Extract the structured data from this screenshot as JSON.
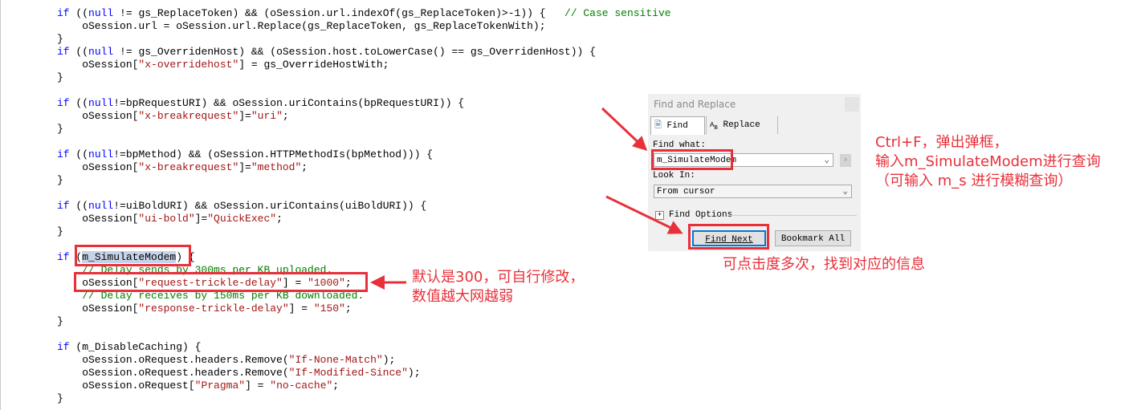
{
  "code_lines": [
    [
      [
        "k",
        "if"
      ],
      [
        "t",
        " (("
      ],
      [
        "k",
        "null"
      ],
      [
        "t",
        " != gs_ReplaceToken) && (oSession.url.indexOf(gs_ReplaceToken)>-1)) {   "
      ],
      [
        "c",
        "// Case sensitive"
      ]
    ],
    [
      [
        "t",
        "    oSession.url = oSession.url.Replace(gs_ReplaceToken, gs_ReplaceTokenWith);"
      ]
    ],
    [
      [
        "t",
        "}"
      ]
    ],
    [
      [
        "k",
        "if"
      ],
      [
        "t",
        " (("
      ],
      [
        "k",
        "null"
      ],
      [
        "t",
        " != gs_OverridenHost) && (oSession.host.toLowerCase() == gs_OverridenHost)) {"
      ]
    ],
    [
      [
        "t",
        "    oSession["
      ],
      [
        "s",
        "\"x-overridehost\""
      ],
      [
        "t",
        "] = gs_OverrideHostWith;"
      ]
    ],
    [
      [
        "t",
        "}"
      ]
    ],
    [],
    [
      [
        "k",
        "if"
      ],
      [
        "t",
        " (("
      ],
      [
        "k",
        "null"
      ],
      [
        "t",
        "!=bpRequestURI) && oSession.uriContains(bpRequestURI)) {"
      ]
    ],
    [
      [
        "t",
        "    oSession["
      ],
      [
        "s",
        "\"x-breakrequest\""
      ],
      [
        "t",
        "]="
      ],
      [
        "s",
        "\"uri\""
      ],
      [
        "t",
        ";"
      ]
    ],
    [
      [
        "t",
        "}"
      ]
    ],
    [],
    [
      [
        "k",
        "if"
      ],
      [
        "t",
        " (("
      ],
      [
        "k",
        "null"
      ],
      [
        "t",
        "!=bpMethod) && (oSession.HTTPMethodIs(bpMethod))) {"
      ]
    ],
    [
      [
        "t",
        "    oSession["
      ],
      [
        "s",
        "\"x-breakrequest\""
      ],
      [
        "t",
        "]="
      ],
      [
        "s",
        "\"method\""
      ],
      [
        "t",
        ";"
      ]
    ],
    [
      [
        "t",
        "}"
      ]
    ],
    [],
    [
      [
        "k",
        "if"
      ],
      [
        "t",
        " (("
      ],
      [
        "k",
        "null"
      ],
      [
        "t",
        "!=uiBoldURI) && oSession.uriContains(uiBoldURI)) {"
      ]
    ],
    [
      [
        "t",
        "    oSession["
      ],
      [
        "s",
        "\"ui-bold\""
      ],
      [
        "t",
        "]="
      ],
      [
        "s",
        "\"QuickExec\""
      ],
      [
        "t",
        ";"
      ]
    ],
    [
      [
        "t",
        "}"
      ]
    ],
    [],
    [
      [
        "k",
        "if"
      ],
      [
        "t",
        " ("
      ],
      [
        "h",
        "m_SimulateModem"
      ],
      [
        "t",
        ") {"
      ]
    ],
    [
      [
        "c",
        "    // Delay sends by 300ms per KB uploaded."
      ]
    ],
    [
      [
        "t",
        "    oSession["
      ],
      [
        "s",
        "\"request-trickle-delay\""
      ],
      [
        "t",
        "] = "
      ],
      [
        "s",
        "\"1000\""
      ],
      [
        "t",
        ";"
      ]
    ],
    [
      [
        "c",
        "    // Delay receives by 150ms per KB downloaded."
      ]
    ],
    [
      [
        "t",
        "    oSession["
      ],
      [
        "s",
        "\"response-trickle-delay\""
      ],
      [
        "t",
        "] = "
      ],
      [
        "s",
        "\"150\""
      ],
      [
        "t",
        ";"
      ]
    ],
    [
      [
        "t",
        "}"
      ]
    ],
    [],
    [
      [
        "k",
        "if"
      ],
      [
        "t",
        " (m_DisableCaching) {"
      ]
    ],
    [
      [
        "t",
        "    oSession.oRequest.headers.Remove("
      ],
      [
        "s",
        "\"If-None-Match\""
      ],
      [
        "t",
        ");"
      ]
    ],
    [
      [
        "t",
        "    oSession.oRequest.headers.Remove("
      ],
      [
        "s",
        "\"If-Modified-Since\""
      ],
      [
        "t",
        ");"
      ]
    ],
    [
      [
        "t",
        "    oSession.oRequest["
      ],
      [
        "s",
        "\"Pragma\""
      ],
      [
        "t",
        "] = "
      ],
      [
        "s",
        "\"no-cache\""
      ],
      [
        "t",
        ";"
      ]
    ],
    [
      [
        "t",
        "}"
      ]
    ]
  ],
  "dialog": {
    "title": "Find and Replace",
    "tab_find": "Find",
    "tab_replace": "Replace",
    "find_what_label": "Find what:",
    "find_what_value": "m_SimulateModem",
    "look_in_label": "Look In:",
    "look_in_value": "From cursor",
    "find_options": "Find Options",
    "find_next": "Find Next",
    "bookmark_all": "Bookmark All"
  },
  "annotations": {
    "note_ctrlf": "Ctrl+F，弹出弹框，\n输入m_SimulateModem进行查询\n（可输入 m_s 进行模糊查询）",
    "note_click": "可点击度多次，找到对应的信息",
    "note_default": "默认是300，可自行修改，\n数值越大网越弱",
    "color": "#e8303a"
  }
}
